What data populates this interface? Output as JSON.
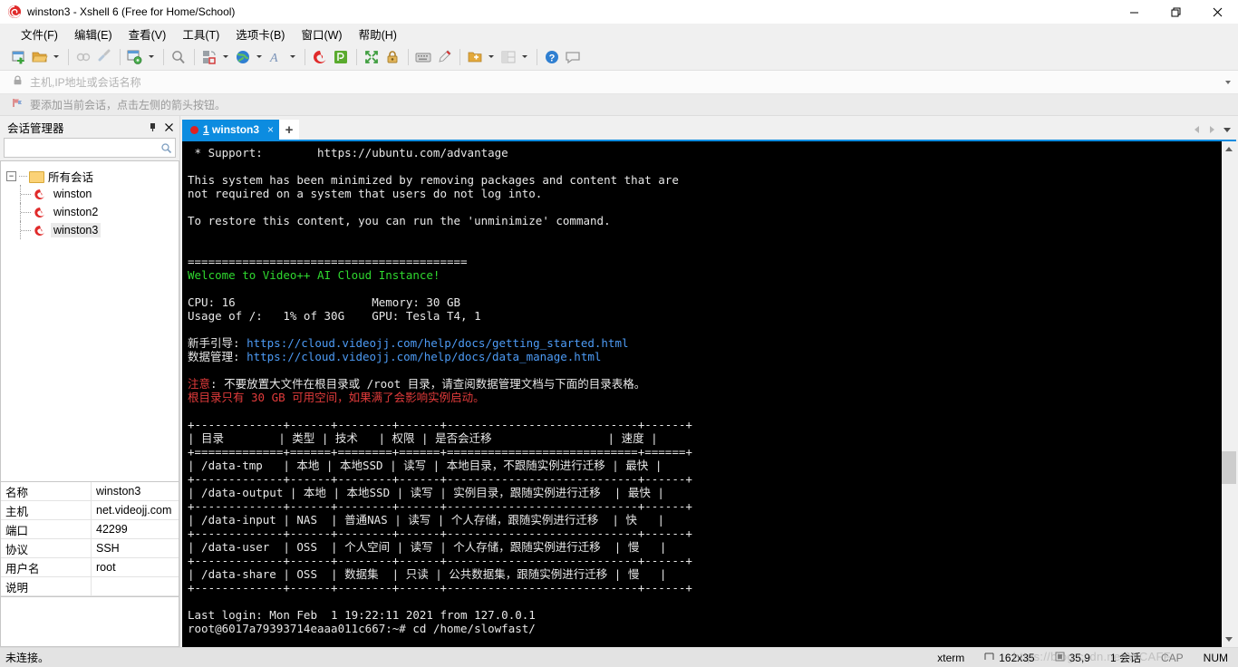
{
  "window": {
    "title": "winston3 - Xshell 6 (Free for Home/School)",
    "app_icon": "xshell-icon",
    "minimize": "—",
    "maximize": "❐",
    "close": "✕"
  },
  "menubar": {
    "items": [
      {
        "label": "文件(F)",
        "name": "menu-file"
      },
      {
        "label": "编辑(E)",
        "name": "menu-edit"
      },
      {
        "label": "查看(V)",
        "name": "menu-view"
      },
      {
        "label": "工具(T)",
        "name": "menu-tools"
      },
      {
        "label": "选项卡(B)",
        "name": "menu-tabs"
      },
      {
        "label": "窗口(W)",
        "name": "menu-window"
      },
      {
        "label": "帮助(H)",
        "name": "menu-help"
      }
    ]
  },
  "toolbar": {
    "icons": [
      "new-session-icon",
      "open-folder-icon",
      "copy-session-icon",
      "disconnect-icon",
      "properties-icon",
      "find-icon",
      "transfer-icon",
      "globe-icon",
      "font-icon",
      "xshell-icon",
      "xftp-icon",
      "fullscreen-icon",
      "lock-icon",
      "keyboard-icon",
      "highlight-icon",
      "add-folder-icon",
      "layout-icon",
      "help-icon",
      "feedback-icon"
    ]
  },
  "addressbar": {
    "lock_icon": "lock-icon",
    "placeholder": "主机,IP地址或会话名称",
    "value": "",
    "dropdown_icon": "chevron-down-icon"
  },
  "hintbar": {
    "icon": "flag-icon",
    "text": "要添加当前会话，点击左侧的箭头按钮。"
  },
  "sidebar": {
    "title": "会话管理器",
    "pin_label": "⊥",
    "close_label": "✕",
    "search": {
      "placeholder": "",
      "value": "",
      "icon": "search-icon"
    },
    "tree": {
      "expander": "−",
      "root": {
        "label": "所有会话",
        "icon": "folder-icon"
      },
      "children": [
        {
          "label": "winston",
          "icon": "session-icon",
          "selected": false
        },
        {
          "label": "winston2",
          "icon": "session-icon",
          "selected": false
        },
        {
          "label": "winston3",
          "icon": "session-icon",
          "selected": true
        }
      ]
    },
    "properties": [
      {
        "key": "名称",
        "value": "winston3"
      },
      {
        "key": "主机",
        "value": "net.videojj.com"
      },
      {
        "key": "端口",
        "value": "42299"
      },
      {
        "key": "协议",
        "value": "SSH"
      },
      {
        "key": "用户名",
        "value": "root"
      },
      {
        "key": "说明",
        "value": ""
      }
    ]
  },
  "tabs": {
    "active": {
      "index": "1",
      "label": "winston3",
      "status_dot_color": "#e02020",
      "close_label": "×"
    },
    "new_tab_label": "+",
    "nav_prev_icon": "chevron-left-icon",
    "nav_next_icon": "chevron-right-icon",
    "nav_menu_icon": "chevron-down-icon"
  },
  "terminal": {
    "lines": [
      [
        {
          "t": " * Support:        https://ubuntu.com/advantage",
          "c": "white"
        }
      ],
      [
        {
          "t": "",
          "c": "white"
        }
      ],
      [
        {
          "t": "This system has been minimized by removing packages and content that are",
          "c": "white"
        }
      ],
      [
        {
          "t": "not required on a system that users do not log into.",
          "c": "white"
        }
      ],
      [
        {
          "t": "",
          "c": "white"
        }
      ],
      [
        {
          "t": "To restore this content, you can run the 'unminimize' command.",
          "c": "white"
        }
      ],
      [
        {
          "t": "",
          "c": "white"
        }
      ],
      [
        {
          "t": "",
          "c": "white"
        }
      ],
      [
        {
          "t": "=========================================",
          "c": "white"
        }
      ],
      [
        {
          "t": "Welcome to Video++ AI Cloud Instance!",
          "c": "green"
        }
      ],
      [
        {
          "t": "",
          "c": "white"
        }
      ],
      [
        {
          "t": "CPU: 16                    Memory: 30 GB",
          "c": "white"
        }
      ],
      [
        {
          "t": "Usage of /:   1% of 30G    GPU: Tesla T4, 1",
          "c": "white"
        }
      ],
      [
        {
          "t": "",
          "c": "white"
        }
      ],
      [
        {
          "t": "新手引导: ",
          "c": "white"
        },
        {
          "t": "https://cloud.videojj.com/help/docs/getting_started.html",
          "c": "blue"
        }
      ],
      [
        {
          "t": "数据管理: ",
          "c": "white"
        },
        {
          "t": "https://cloud.videojj.com/help/docs/data_manage.html",
          "c": "blue"
        }
      ],
      [
        {
          "t": "",
          "c": "white"
        }
      ],
      [
        {
          "t": "注意",
          "c": "red"
        },
        {
          "t": ": 不要放置大文件在根目录或 /root 目录，请查阅数据管理文档与下面的目录表格。",
          "c": "white"
        }
      ],
      [
        {
          "t": "根目录只有 30 GB 可用空间，如果满了会影响实例启动。",
          "c": "red"
        }
      ],
      [
        {
          "t": "",
          "c": "white"
        }
      ],
      [
        {
          "t": "+-------------+------+--------+------+----------------------------+------+",
          "c": "white"
        }
      ],
      [
        {
          "t": "| 目录        | 类型 | 技术   | 权限 | 是否会迁移                 | 速度 |",
          "c": "white"
        }
      ],
      [
        {
          "t": "+=============+======+========+======+============================+======+",
          "c": "white"
        }
      ],
      [
        {
          "t": "| /data-tmp   | 本地 | 本地SSD | 读写 | 本地目录，不跟随实例进行迁移 | 最快 |",
          "c": "white"
        }
      ],
      [
        {
          "t": "+-------------+------+--------+------+----------------------------+------+",
          "c": "white"
        }
      ],
      [
        {
          "t": "| /data-output | 本地 | 本地SSD | 读写 | 实例目录，跟随实例进行迁移  | 最快 |",
          "c": "white"
        }
      ],
      [
        {
          "t": "+-------------+------+--------+------+----------------------------+------+",
          "c": "white"
        }
      ],
      [
        {
          "t": "| /data-input | NAS  | 普通NAS | 读写 | 个人存储，跟随实例进行迁移  | 快   |",
          "c": "white"
        }
      ],
      [
        {
          "t": "+-------------+------+--------+------+----------------------------+------+",
          "c": "white"
        }
      ],
      [
        {
          "t": "| /data-user  | OSS  | 个人空间 | 读写 | 个人存储，跟随实例进行迁移  | 慢   |",
          "c": "white"
        }
      ],
      [
        {
          "t": "+-------------+------+--------+------+----------------------------+------+",
          "c": "white"
        }
      ],
      [
        {
          "t": "| /data-share | OSS  | 数据集  | 只读 | 公共数据集，跟随实例进行迁移 | 慢   |",
          "c": "white"
        }
      ],
      [
        {
          "t": "+-------------+------+--------+------+----------------------------+------+",
          "c": "white"
        }
      ],
      [
        {
          "t": "",
          "c": "white"
        }
      ],
      [
        {
          "t": "Last login: Mon Feb  1 19:22:11 2021 from 127.0.0.1",
          "c": "white"
        }
      ],
      [
        {
          "t": "root@6017a79393714eaaa011c667:~# cd /home/slowfast/",
          "c": "white"
        }
      ]
    ],
    "scrollbar": {
      "up_icon": "chevron-up-icon",
      "down_icon": "chevron-down-icon"
    }
  },
  "statusbar": {
    "left_text": "未连接。",
    "term_type": "xterm",
    "size_icon": "resize-icon",
    "size": "162x35",
    "cursor_icon": "cursor-icon",
    "cursor_pos": "35,9",
    "sessions": "1 会话",
    "caps": "CAP",
    "num": "NUM",
    "watermark": "https://blog.csdn.net/WCAFF"
  },
  "colors": {
    "accent": "#0c8ce0",
    "terminal_bg": "#000000",
    "terminal_fg": "#d8d8d8",
    "green": "#2fd82f",
    "blue": "#4d9bf5",
    "red": "#e23b3b",
    "chrome": "#f0f0f0"
  }
}
